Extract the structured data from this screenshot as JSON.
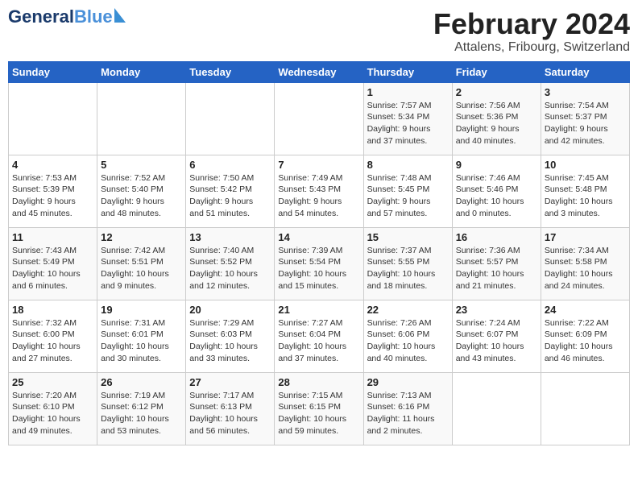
{
  "header": {
    "logo_line1": "General",
    "logo_line2": "Blue",
    "month": "February 2024",
    "location": "Attalens, Fribourg, Switzerland"
  },
  "weekdays": [
    "Sunday",
    "Monday",
    "Tuesday",
    "Wednesday",
    "Thursday",
    "Friday",
    "Saturday"
  ],
  "weeks": [
    [
      {
        "day": "",
        "info": ""
      },
      {
        "day": "",
        "info": ""
      },
      {
        "day": "",
        "info": ""
      },
      {
        "day": "",
        "info": ""
      },
      {
        "day": "1",
        "info": "Sunrise: 7:57 AM\nSunset: 5:34 PM\nDaylight: 9 hours\nand 37 minutes."
      },
      {
        "day": "2",
        "info": "Sunrise: 7:56 AM\nSunset: 5:36 PM\nDaylight: 9 hours\nand 40 minutes."
      },
      {
        "day": "3",
        "info": "Sunrise: 7:54 AM\nSunset: 5:37 PM\nDaylight: 9 hours\nand 42 minutes."
      }
    ],
    [
      {
        "day": "4",
        "info": "Sunrise: 7:53 AM\nSunset: 5:39 PM\nDaylight: 9 hours\nand 45 minutes."
      },
      {
        "day": "5",
        "info": "Sunrise: 7:52 AM\nSunset: 5:40 PM\nDaylight: 9 hours\nand 48 minutes."
      },
      {
        "day": "6",
        "info": "Sunrise: 7:50 AM\nSunset: 5:42 PM\nDaylight: 9 hours\nand 51 minutes."
      },
      {
        "day": "7",
        "info": "Sunrise: 7:49 AM\nSunset: 5:43 PM\nDaylight: 9 hours\nand 54 minutes."
      },
      {
        "day": "8",
        "info": "Sunrise: 7:48 AM\nSunset: 5:45 PM\nDaylight: 9 hours\nand 57 minutes."
      },
      {
        "day": "9",
        "info": "Sunrise: 7:46 AM\nSunset: 5:46 PM\nDaylight: 10 hours\nand 0 minutes."
      },
      {
        "day": "10",
        "info": "Sunrise: 7:45 AM\nSunset: 5:48 PM\nDaylight: 10 hours\nand 3 minutes."
      }
    ],
    [
      {
        "day": "11",
        "info": "Sunrise: 7:43 AM\nSunset: 5:49 PM\nDaylight: 10 hours\nand 6 minutes."
      },
      {
        "day": "12",
        "info": "Sunrise: 7:42 AM\nSunset: 5:51 PM\nDaylight: 10 hours\nand 9 minutes."
      },
      {
        "day": "13",
        "info": "Sunrise: 7:40 AM\nSunset: 5:52 PM\nDaylight: 10 hours\nand 12 minutes."
      },
      {
        "day": "14",
        "info": "Sunrise: 7:39 AM\nSunset: 5:54 PM\nDaylight: 10 hours\nand 15 minutes."
      },
      {
        "day": "15",
        "info": "Sunrise: 7:37 AM\nSunset: 5:55 PM\nDaylight: 10 hours\nand 18 minutes."
      },
      {
        "day": "16",
        "info": "Sunrise: 7:36 AM\nSunset: 5:57 PM\nDaylight: 10 hours\nand 21 minutes."
      },
      {
        "day": "17",
        "info": "Sunrise: 7:34 AM\nSunset: 5:58 PM\nDaylight: 10 hours\nand 24 minutes."
      }
    ],
    [
      {
        "day": "18",
        "info": "Sunrise: 7:32 AM\nSunset: 6:00 PM\nDaylight: 10 hours\nand 27 minutes."
      },
      {
        "day": "19",
        "info": "Sunrise: 7:31 AM\nSunset: 6:01 PM\nDaylight: 10 hours\nand 30 minutes."
      },
      {
        "day": "20",
        "info": "Sunrise: 7:29 AM\nSunset: 6:03 PM\nDaylight: 10 hours\nand 33 minutes."
      },
      {
        "day": "21",
        "info": "Sunrise: 7:27 AM\nSunset: 6:04 PM\nDaylight: 10 hours\nand 37 minutes."
      },
      {
        "day": "22",
        "info": "Sunrise: 7:26 AM\nSunset: 6:06 PM\nDaylight: 10 hours\nand 40 minutes."
      },
      {
        "day": "23",
        "info": "Sunrise: 7:24 AM\nSunset: 6:07 PM\nDaylight: 10 hours\nand 43 minutes."
      },
      {
        "day": "24",
        "info": "Sunrise: 7:22 AM\nSunset: 6:09 PM\nDaylight: 10 hours\nand 46 minutes."
      }
    ],
    [
      {
        "day": "25",
        "info": "Sunrise: 7:20 AM\nSunset: 6:10 PM\nDaylight: 10 hours\nand 49 minutes."
      },
      {
        "day": "26",
        "info": "Sunrise: 7:19 AM\nSunset: 6:12 PM\nDaylight: 10 hours\nand 53 minutes."
      },
      {
        "day": "27",
        "info": "Sunrise: 7:17 AM\nSunset: 6:13 PM\nDaylight: 10 hours\nand 56 minutes."
      },
      {
        "day": "28",
        "info": "Sunrise: 7:15 AM\nSunset: 6:15 PM\nDaylight: 10 hours\nand 59 minutes."
      },
      {
        "day": "29",
        "info": "Sunrise: 7:13 AM\nSunset: 6:16 PM\nDaylight: 11 hours\nand 2 minutes."
      },
      {
        "day": "",
        "info": ""
      },
      {
        "day": "",
        "info": ""
      }
    ]
  ]
}
